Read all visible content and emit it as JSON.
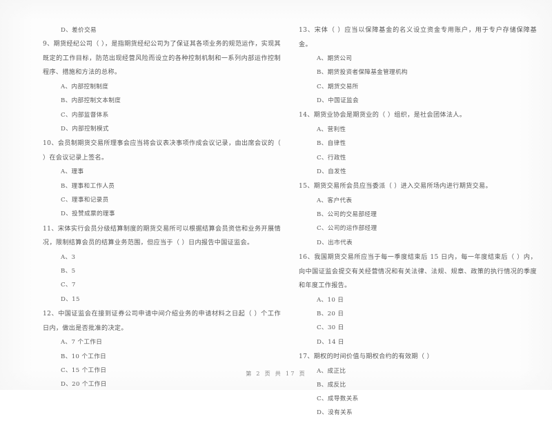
{
  "document": {
    "type": "scanned-exam-paper",
    "language": "zh-CN",
    "footer": "第 2 页 共 17 页"
  },
  "left_column": {
    "orphan_option": "D、差价交易",
    "questions": [
      {
        "number": "9",
        "stem": "9、期货经纪公司（        ），是指期货经纪公司为了保证其各项业务的规范运作，实现其既定的工作目标，防范出现经营风险而设立的各种控制机制和一系列内部运作控制程序、措施和方法的总称。",
        "options": [
          "A、内部控制制度",
          "B、内部控制文本制度",
          "C、内部监督体系",
          "D、内部控制模式"
        ]
      },
      {
        "number": "10",
        "stem": "10、会员制期货交易所理事会应当将会议表决事项作成会议记录，由出席会议的（        ）在会议记录上签名。",
        "options": [
          "A、理事",
          "B、理事和工作人员",
          "C、理事和记录员",
          "D、投赞成票的理事"
        ]
      },
      {
        "number": "11",
        "stem": "11、宋体实行会员分级结算制度的期货交易所可以根据结算会员资信和业务开展情况，限制结算会员的结算业务范围，但应当于（        ）日内报告中国证监会。",
        "options": [
          "A、3",
          "B、5",
          "C、7",
          "D、15"
        ]
      },
      {
        "number": "12",
        "stem": "12、中国证监会在接到证券公司申请中间介绍业务的申请材料之日起（        ）个工作日内，做出是否批准的决定。",
        "options": [
          "A、7 个工作日",
          "B、10 个工作日",
          "C、15 个工作日",
          "D、20 个工作日"
        ]
      }
    ]
  },
  "right_column": {
    "questions": [
      {
        "number": "13",
        "stem": "13、宋体（      ）应当以保障基金的名义设立资金专用账户，用于专户存储保障基金。",
        "options": [
          "A、期货公司",
          "B、期货投资者保障基金管理机构",
          "C、期货交易所",
          "D、中国证监会"
        ]
      },
      {
        "number": "14",
        "stem": "14、期货业协会是期货业的（       ）组织，是社会团体法人。",
        "options": [
          "A、营利性",
          "B、自律性",
          "C、行政性",
          "D、自发性"
        ]
      },
      {
        "number": "15",
        "stem": "15、期货交易所会员应当委派（       ）进入交易所场内进行期货交易。",
        "options": [
          "A、客户代表",
          "B、公司的交易部经理",
          "C、公司的运作部经理",
          "D、出市代表"
        ]
      },
      {
        "number": "16",
        "stem": "16、我国期货交易所应当于每一季度结束后 15 日内，每一年度结束后（        ）内，向中国证监会提交有关经营情况和有关法律、法规、规章、政策的执行情况的季度和年度工作报告。",
        "options": [
          "A、10 日",
          "B、20 日",
          "C、30 日",
          "D、14 日"
        ]
      },
      {
        "number": "17",
        "stem": "17、期权的时间价值与期权合约的有效期（       ）",
        "options": [
          "A、成正比",
          "B、成反比",
          "C、成导数关系",
          "D、没有关系"
        ]
      }
    ]
  }
}
